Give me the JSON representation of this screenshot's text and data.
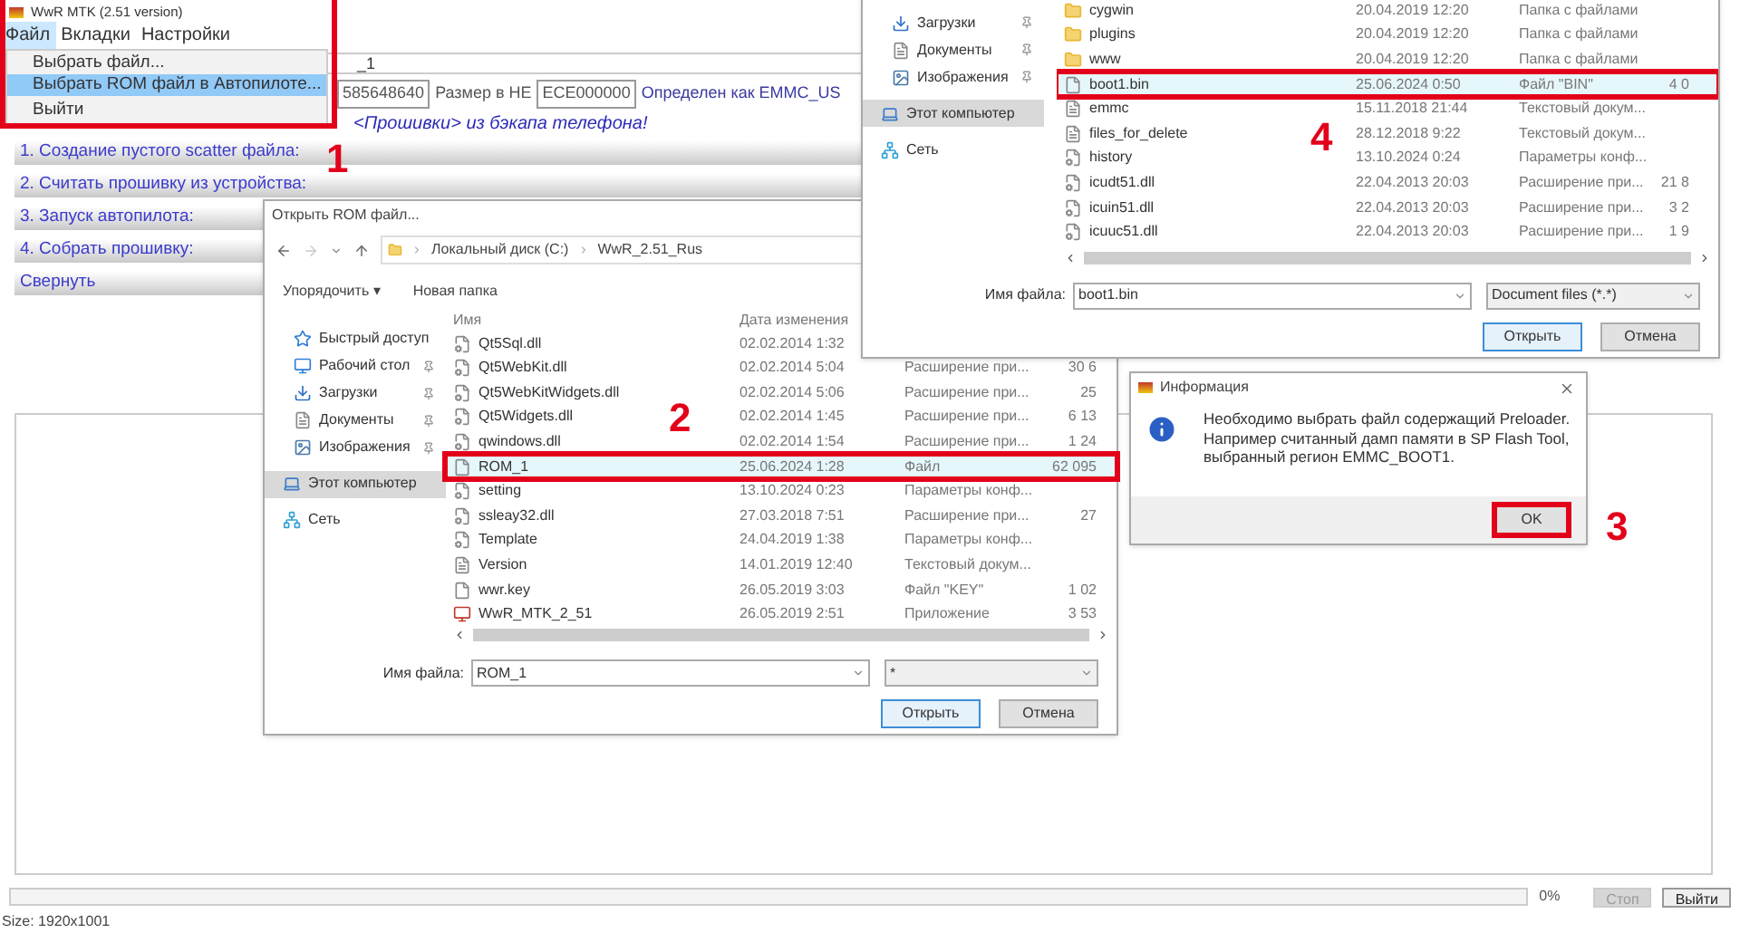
{
  "app": {
    "title": "WwR MTK (2.51 version)",
    "menu": [
      {
        "label": "Файл",
        "selected": true
      },
      {
        "label": "Вкладки",
        "selected": false
      },
      {
        "label": "Настройки",
        "selected": false
      }
    ],
    "dropdown": [
      {
        "label": "Выбрать файл...",
        "selected": false
      },
      {
        "label": "Выбрать ROM файл в Автопилоте...",
        "selected": true
      },
      {
        "label": "Выйти",
        "selected": false
      }
    ],
    "file_field": "_1",
    "info_row": {
      "field_1": "585648640",
      "size_label": "Размер в НЕ",
      "field_2": "ECE000000",
      "detected": "Определен как EMMC_US"
    },
    "notice": "<Прошивки> из бэкапа телефона!",
    "sections": [
      "1. Создание пустого scatter файла:",
      "2. Считать прошивку из устройства:",
      "3. Запуск автопилота:",
      "4. Собрать прошивку:",
      "Свернуть"
    ],
    "progress": {
      "level": 0,
      "reading": "0%"
    },
    "buttons": [
      {
        "label": "Стоп",
        "disabled": true
      },
      {
        "label": "Выйти",
        "disabled": false
      }
    ],
    "status": "Size: 1920x1001",
    "annotation": "1"
  },
  "dialog_rom": {
    "title": "Открыть ROM файл...",
    "path": [
      "Локальный диск (C:)",
      "WwR_2.51_Rus"
    ],
    "toolbar": [
      "Упорядочить ▾",
      "Новая папка"
    ],
    "columns": [
      "Имя",
      "Дата изменения"
    ],
    "sidebar": [
      {
        "label": "Быстрый доступ",
        "kind": "star",
        "pinned": false,
        "selected": false
      },
      {
        "label": "Рабочий стол",
        "kind": "desktop",
        "pinned": true,
        "selected": false
      },
      {
        "label": "Загрузки",
        "kind": "download",
        "pinned": true,
        "selected": false
      },
      {
        "label": "Документы",
        "kind": "docs",
        "pinned": true,
        "selected": false
      },
      {
        "label": "Изображения",
        "kind": "images",
        "pinned": true,
        "selected": false
      },
      {
        "label": "Этот компьютер",
        "kind": "computer",
        "pinned": false,
        "selected": true
      },
      {
        "label": "Сеть",
        "kind": "network",
        "pinned": false,
        "selected": false
      }
    ],
    "rows": [
      {
        "name": "Qt5Sql.dll",
        "date": "02.02.2014 1:32",
        "kind": "dll",
        "selected": false
      },
      {
        "name": "Qt5WebKit.dll",
        "date": "02.02.2014 5:04",
        "type": "Расширение при...",
        "size": "30 6",
        "kind": "dll",
        "selected": false
      },
      {
        "name": "Qt5WebKitWidgets.dll",
        "date": "02.02.2014 5:06",
        "type": "Расширение при...",
        "size": "25",
        "kind": "dll",
        "selected": false
      },
      {
        "name": "Qt5Widgets.dll",
        "date": "02.02.2014 1:45",
        "type": "Расширение при...",
        "size": "6 13",
        "kind": "dll",
        "selected": false
      },
      {
        "name": "qwindows.dll",
        "date": "02.02.2014 1:54",
        "type": "Расширение при...",
        "size": "1 24",
        "kind": "dll",
        "selected": false
      },
      {
        "name": "ROM_1",
        "date": "25.06.2024 1:28",
        "type": "Файл",
        "size": "62 095",
        "kind": "file",
        "selected": true
      },
      {
        "name": "setting",
        "date": "13.10.2024 0:23",
        "type": "Параметры конф...",
        "kind": "config",
        "selected": false
      },
      {
        "name": "ssleay32.dll",
        "date": "27.03.2018 7:51",
        "type": "Расширение при...",
        "size": "27",
        "kind": "dll",
        "selected": false
      },
      {
        "name": "Template",
        "date": "24.04.2019 1:38",
        "type": "Параметры конф...",
        "kind": "config",
        "selected": false
      },
      {
        "name": "Version",
        "date": "14.01.2019 12:40",
        "type": "Текстовый докум...",
        "kind": "text",
        "selected": false
      },
      {
        "name": "wwr.key",
        "date": "26.05.2019 3:03",
        "type": "Файл \"KEY\"",
        "size": "1 02",
        "kind": "file",
        "selected": false
      },
      {
        "name": "WwR_MTK_2_51",
        "date": "26.05.2019 2:51",
        "type": "Приложение",
        "size": "3 53",
        "kind": "app",
        "selected": false
      }
    ],
    "filename_label": "Имя файла:",
    "filename": "ROM_1",
    "filter": "*",
    "buttons": [
      {
        "label": "Открыть",
        "default": true
      },
      {
        "label": "Отмена",
        "default": false
      }
    ],
    "annotation": "2"
  },
  "dialog_boot": {
    "sidebar": [
      {
        "label": "Загрузки",
        "kind": "download",
        "pinned": true,
        "selected": false
      },
      {
        "label": "Документы",
        "kind": "docs",
        "pinned": true,
        "selected": false
      },
      {
        "label": "Изображения",
        "kind": "images",
        "pinned": true,
        "selected": false
      },
      {
        "label": "Этот компьютер",
        "kind": "computer",
        "pinned": false,
        "selected": true
      },
      {
        "label": "Сеть",
        "kind": "network",
        "pinned": false,
        "selected": false
      }
    ],
    "rows": [
      {
        "name": "cygwin",
        "date": "20.04.2019 12:20",
        "type": "Папка с файлами",
        "kind": "folder",
        "selected": false
      },
      {
        "name": "plugins",
        "date": "20.04.2019 12:20",
        "type": "Папка с файлами",
        "kind": "folder",
        "selected": false
      },
      {
        "name": "www",
        "date": "20.04.2019 12:20",
        "type": "Папка с файлами",
        "kind": "folder",
        "selected": false
      },
      {
        "name": "boot1.bin",
        "date": "25.06.2024 0:50",
        "type": "Файл \"BIN\"",
        "size": "4 0",
        "kind": "file",
        "selected": true
      },
      {
        "name": "emmc",
        "date": "15.11.2018 21:44",
        "type": "Текстовый докум...",
        "kind": "text",
        "selected": false
      },
      {
        "name": "files_for_delete",
        "date": "28.12.2018 9:22",
        "type": "Текстовый докум...",
        "kind": "text",
        "selected": false
      },
      {
        "name": "history",
        "date": "13.10.2024 0:24",
        "type": "Параметры конф...",
        "kind": "config",
        "selected": false
      },
      {
        "name": "icudt51.dll",
        "date": "22.04.2013 20:03",
        "type": "Расширение при...",
        "size": "21 8",
        "kind": "dll",
        "selected": false
      },
      {
        "name": "icuin51.dll",
        "date": "22.04.2013 20:03",
        "type": "Расширение при...",
        "size": "3 2",
        "kind": "dll",
        "selected": false
      },
      {
        "name": "icuuc51.dll",
        "date": "22.04.2013 20:03",
        "type": "Расширение при...",
        "size": "1 9",
        "kind": "dll",
        "selected": false
      }
    ],
    "filename_label": "Имя файла:",
    "filename": "boot1.bin",
    "filter": "Document files (*.*)",
    "buttons": [
      {
        "label": "Открыть",
        "default": true
      },
      {
        "label": "Отмена",
        "default": false
      }
    ],
    "annotation": "4"
  },
  "info_dialog": {
    "title": "Информация",
    "message": "Необходимо выбрать файл содержащий Preloader.\nНапример считанный дамп памяти в SP Flash Tool, выбранный регион EMMC_BOOT1.",
    "button": "OK",
    "annotation": "3"
  }
}
